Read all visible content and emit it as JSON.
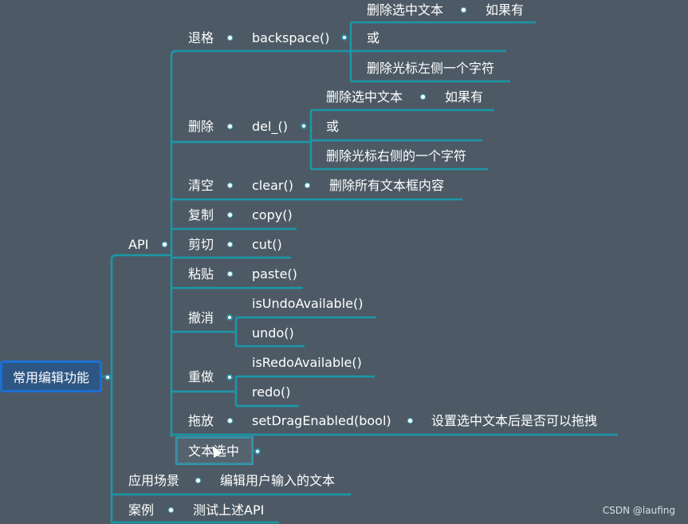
{
  "root": "常用编辑功能",
  "api": "API",
  "items": {
    "backspace": {
      "label": "退格",
      "func": "backspace()",
      "sub1": "删除选中文本",
      "sub1b": "如果有",
      "sub2": "或",
      "sub3": "删除光标左侧一个字符"
    },
    "del": {
      "label": "删除",
      "func": "del_()",
      "sub1": "删除选中文本",
      "sub1b": "如果有",
      "sub2": "或",
      "sub3": "删除光标右侧的一个字符"
    },
    "clear": {
      "label": "清空",
      "func": "clear()",
      "desc": "删除所有文本框内容"
    },
    "copy": {
      "label": "复制",
      "func": "copy()"
    },
    "cut": {
      "label": "剪切",
      "func": "cut()"
    },
    "paste": {
      "label": "粘贴",
      "func": "paste()"
    },
    "undo": {
      "label": "撤消",
      "f1": "isUndoAvailable()",
      "f2": "undo()"
    },
    "redo": {
      "label": "重做",
      "f1": "isRedoAvailable()",
      "f2": "redo()"
    },
    "drag": {
      "label": "拖放",
      "func": "setDragEnabled(bool)",
      "desc": "设置选中文本后是否可以拖拽"
    },
    "select": {
      "label": "文本选中"
    }
  },
  "scene": {
    "label": "应用场景",
    "desc": "编辑用户输入的文本"
  },
  "case": {
    "label": "案例",
    "desc": "测试上述API"
  },
  "watermark": "CSDN @laufing"
}
